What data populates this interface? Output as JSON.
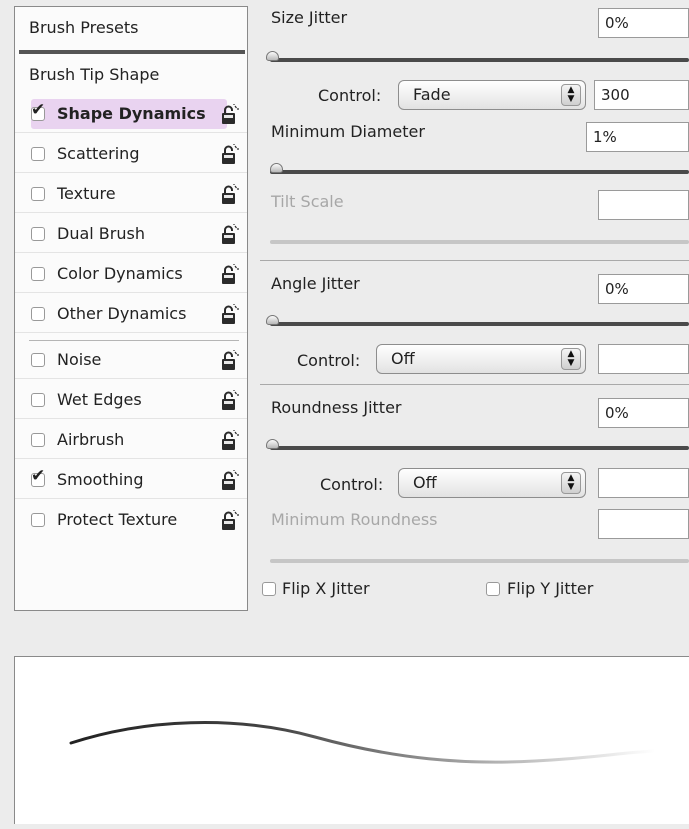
{
  "left_panel": {
    "brush_presets": "Brush Presets",
    "brush_tip_shape": "Brush Tip Shape",
    "options": [
      {
        "label": "Shape Dynamics",
        "checked": true
      },
      {
        "label": "Scattering",
        "checked": false
      },
      {
        "label": "Texture",
        "checked": false
      },
      {
        "label": "Dual Brush",
        "checked": false
      },
      {
        "label": "Color Dynamics",
        "checked": false
      },
      {
        "label": "Other Dynamics",
        "checked": false
      },
      {
        "label": "Noise",
        "checked": false
      },
      {
        "label": "Wet Edges",
        "checked": false
      },
      {
        "label": "Airbrush",
        "checked": false
      },
      {
        "label": "Smoothing",
        "checked": true
      },
      {
        "label": "Protect Texture",
        "checked": false
      }
    ],
    "icons": {
      "lock": "lock-icon",
      "check": "checkmark-icon"
    }
  },
  "settings": {
    "size_jitter": {
      "label": "Size Jitter",
      "value": "0%",
      "slider": 0
    },
    "size_control": {
      "label": "Control:",
      "value": "Fade",
      "field": "300"
    },
    "minimum_diameter": {
      "label": "Minimum Diameter",
      "value": "1%",
      "slider": 0.01
    },
    "tilt_scale": {
      "label": "Tilt Scale",
      "value": ""
    },
    "angle_jitter": {
      "label": "Angle Jitter",
      "value": "0%",
      "slider": 0
    },
    "angle_control": {
      "label": "Control:",
      "value": "Off",
      "field": ""
    },
    "roundness_jitter": {
      "label": "Roundness Jitter",
      "value": "0%",
      "slider": 0
    },
    "roundness_control": {
      "label": "Control:",
      "value": "Off",
      "field": ""
    },
    "minimum_roundness": {
      "label": "Minimum Roundness",
      "value": ""
    },
    "flip_x": {
      "label": "Flip X Jitter",
      "checked": false
    },
    "flip_y": {
      "label": "Flip Y Jitter",
      "checked": false
    }
  },
  "colors": {
    "highlight": "#e9d3f0",
    "panel_bg": "#ececec"
  }
}
